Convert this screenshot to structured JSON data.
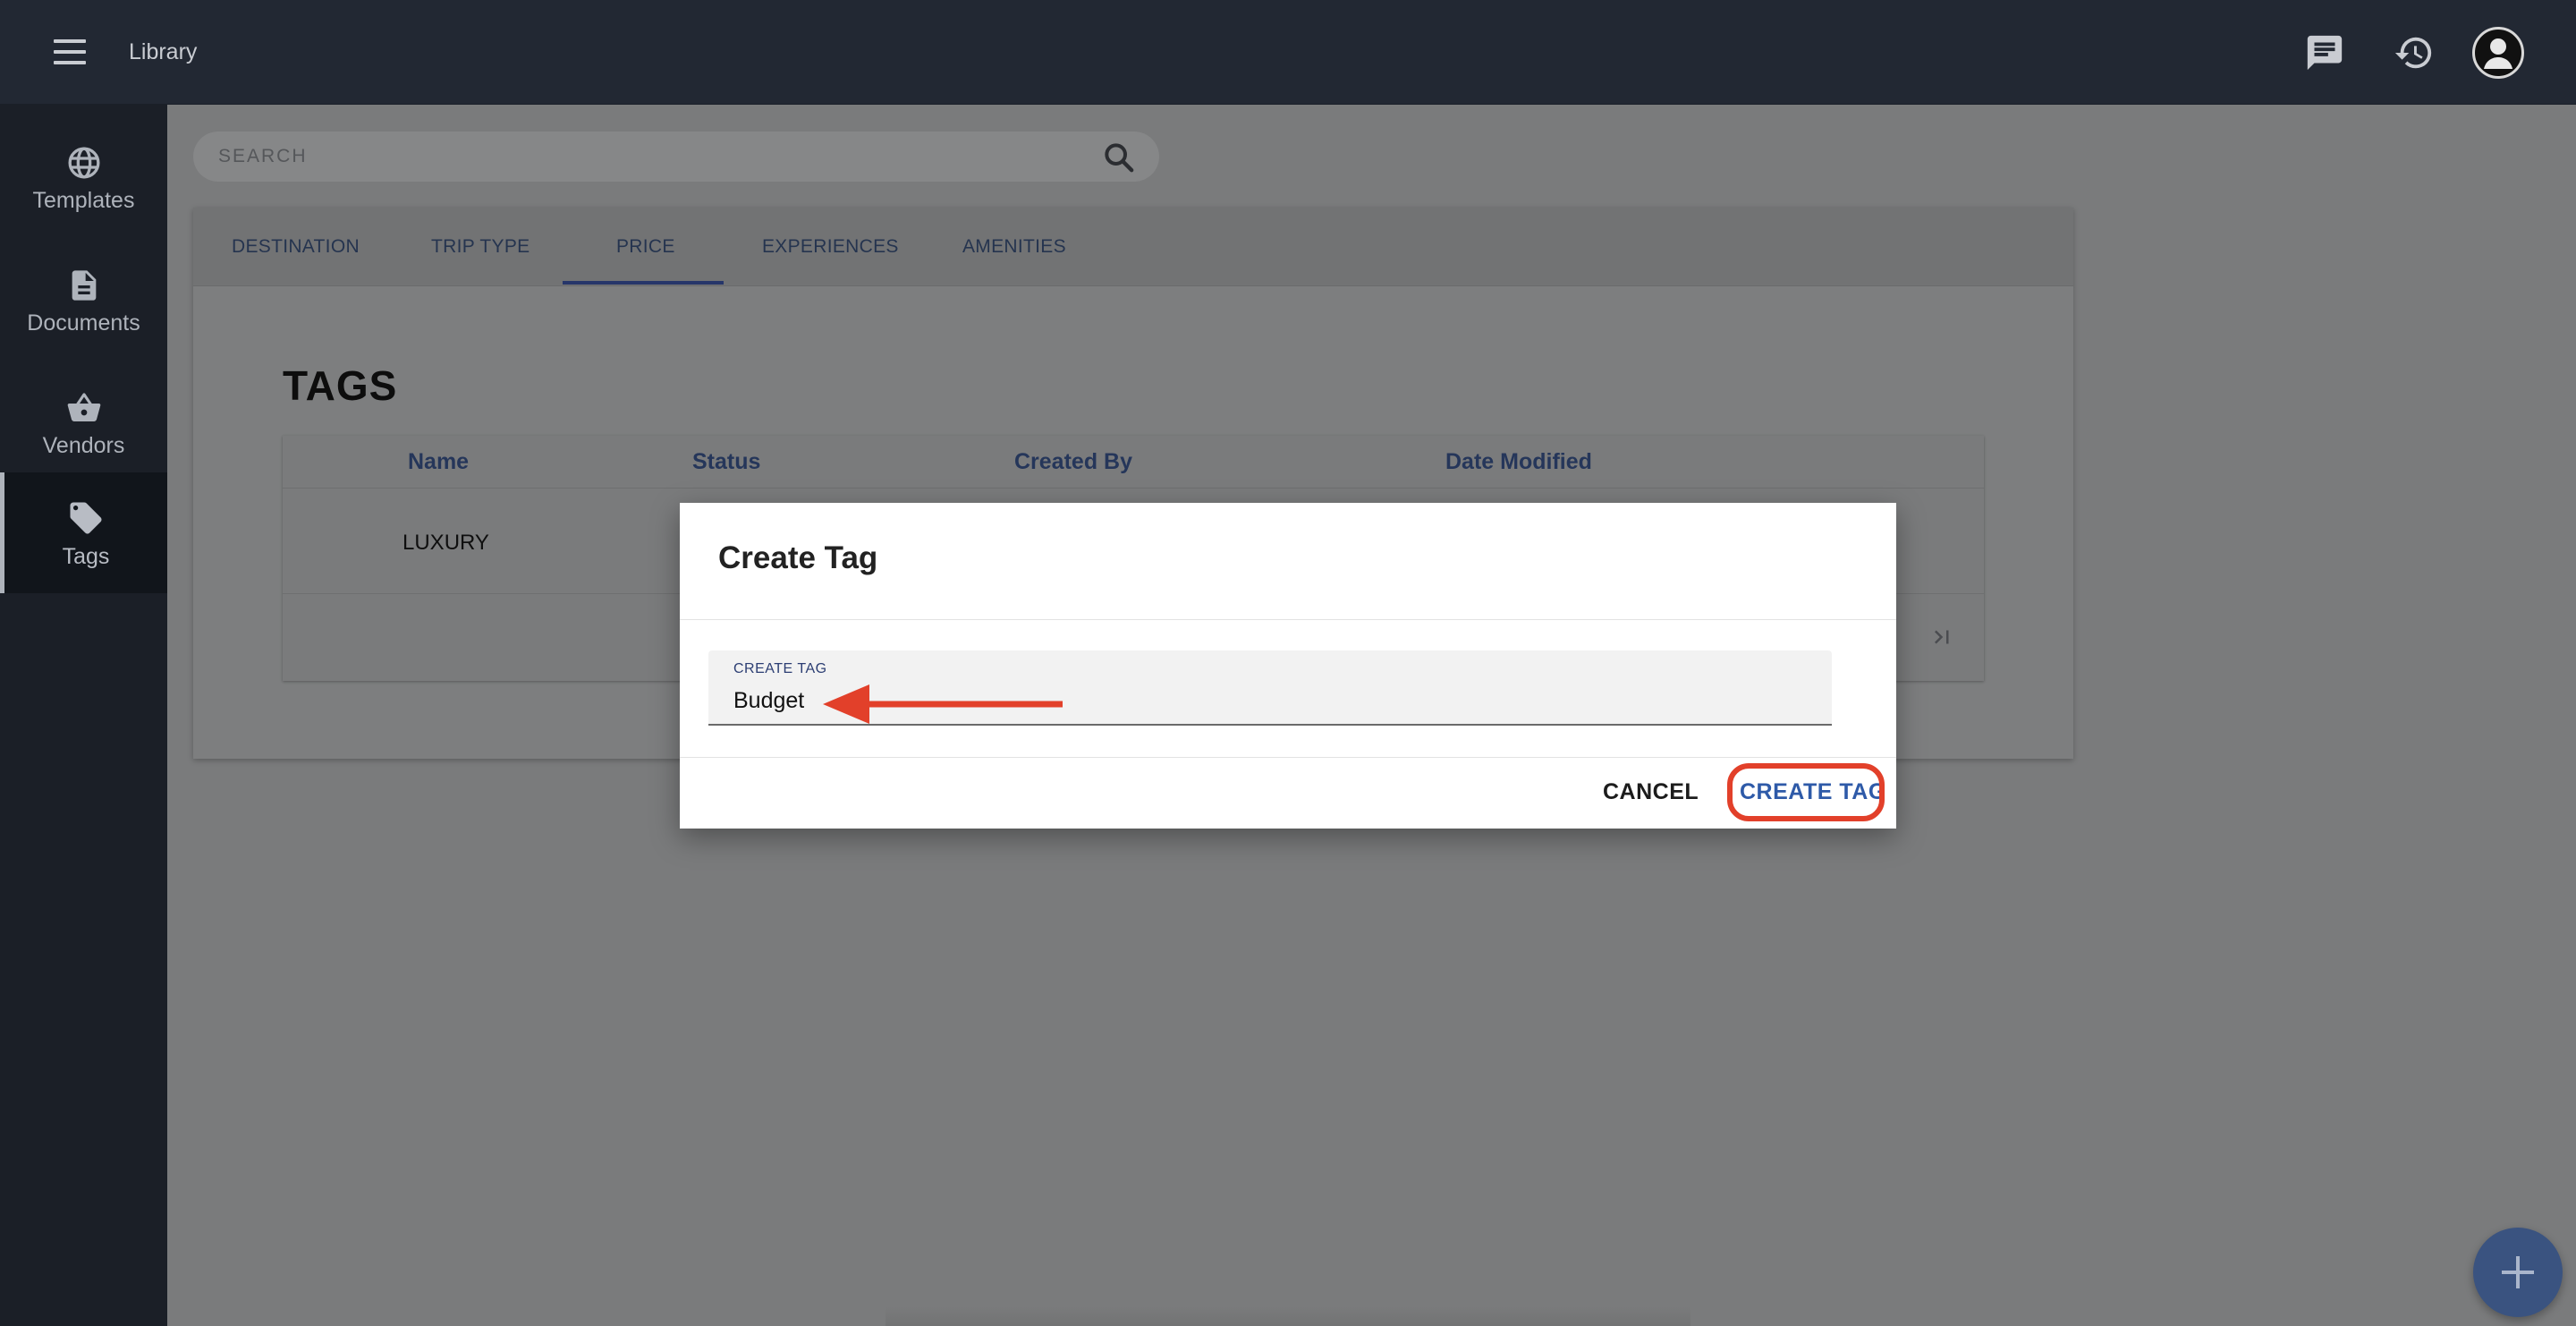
{
  "app": {
    "title": "Library"
  },
  "topbar": {
    "icons": [
      "menu-icon",
      "chat-icon",
      "history-icon",
      "avatar"
    ]
  },
  "sidebar": {
    "items": [
      {
        "label": "Templates",
        "icon": "globe-icon",
        "active": false
      },
      {
        "label": "Documents",
        "icon": "document-icon",
        "active": false
      },
      {
        "label": "Vendors",
        "icon": "basket-icon",
        "active": false
      },
      {
        "label": "Tags",
        "icon": "tag-icon",
        "active": true
      }
    ]
  },
  "search": {
    "placeholder": "SEARCH",
    "value": ""
  },
  "tabs": [
    {
      "label": "DESTINATION"
    },
    {
      "label": "TRIP TYPE"
    },
    {
      "label": "PRICE",
      "active": true
    },
    {
      "label": "EXPERIENCES"
    },
    {
      "label": "AMENITIES"
    }
  ],
  "tags_section": {
    "title": "TAGS",
    "columns": [
      "Name",
      "Status",
      "Created By",
      "Date Modified"
    ],
    "rows": [
      {
        "name": "LUXURY"
      }
    ]
  },
  "dialog": {
    "title": "Create Tag",
    "field_label": "CREATE TAG",
    "field_value": "Budget",
    "cancel_label": "CANCEL",
    "create_label": "CREATE TAG"
  },
  "colors": {
    "accent": "#2e5aa8",
    "annotation": "#e2402a",
    "topbar": "#222833",
    "sidebar": "#1b1f27"
  }
}
